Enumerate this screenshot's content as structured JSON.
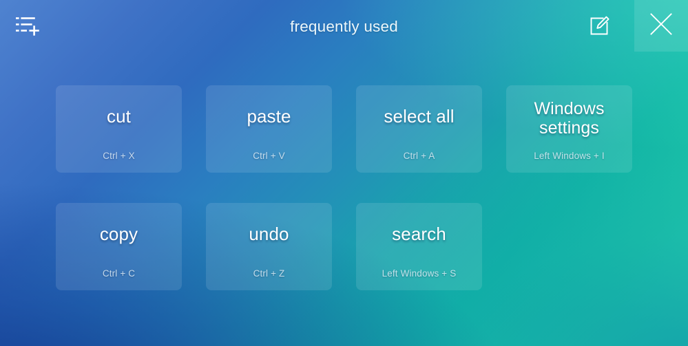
{
  "window": {
    "title": "frequently used"
  },
  "titlebar": {
    "add_list_icon": "list-add-icon",
    "edit_icon": "edit-square-pencil-icon",
    "close_icon": "close-x-icon",
    "add_list_label": "add to list",
    "edit_label": "edit",
    "close_label": "close"
  },
  "colors": {
    "gradient_top_left": "#4f83d0",
    "gradient_bottom_left": "#1f47a0",
    "gradient_top_right": "#3cdcb4",
    "gradient_bottom_right": "#0f8fa3",
    "tile_fill": "rgba(255,255,255,0.11)",
    "title_text": "#ecf7fb",
    "tile_label_text": "#ffffff",
    "tile_shortcut_text": "rgba(236,246,252,0.78)"
  },
  "rows": [
    {
      "tiles": [
        {
          "label": "cut",
          "shortcut": "Ctrl + X",
          "two_line": false
        },
        {
          "label": "paste",
          "shortcut": "Ctrl + V",
          "two_line": false
        },
        {
          "label": "select all",
          "shortcut": "Ctrl + A",
          "two_line": false
        },
        {
          "label": "Windows settings",
          "shortcut": "Left Windows + I",
          "two_line": true
        }
      ]
    },
    {
      "tiles": [
        {
          "label": "copy",
          "shortcut": "Ctrl + C",
          "two_line": false
        },
        {
          "label": "undo",
          "shortcut": "Ctrl + Z",
          "two_line": false
        },
        {
          "label": "search",
          "shortcut": "Left Windows + S",
          "two_line": false
        }
      ]
    }
  ]
}
